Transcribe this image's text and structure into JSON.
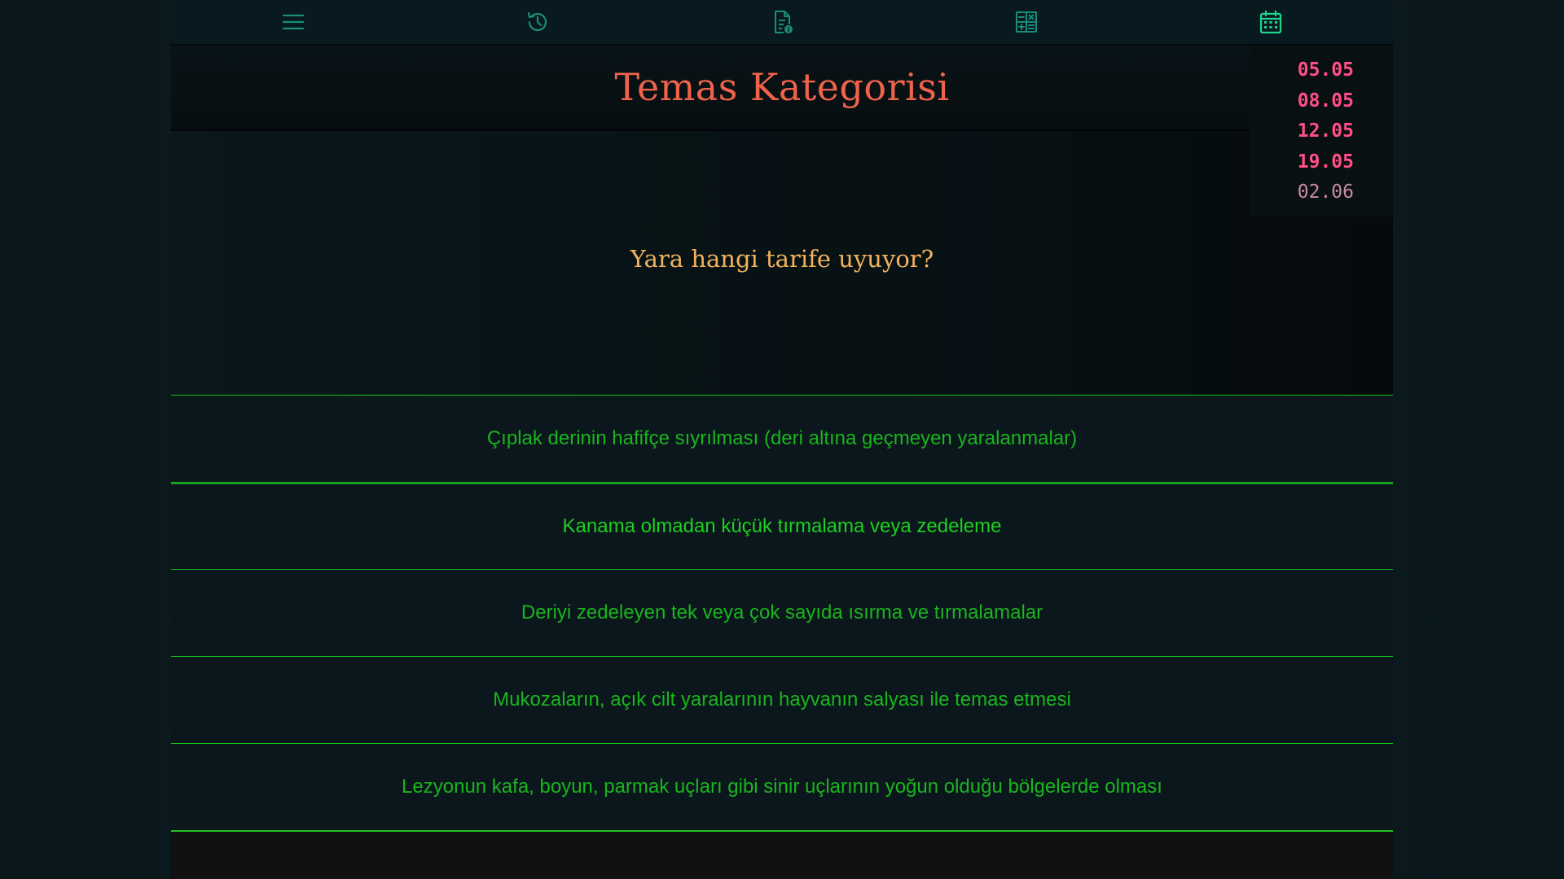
{
  "nav": {
    "items": [
      {
        "icon": "menu-icon"
      },
      {
        "icon": "history-icon"
      },
      {
        "icon": "document-info-icon"
      },
      {
        "icon": "calculator-icon"
      },
      {
        "icon": "calendar-icon",
        "active": true
      }
    ],
    "icon_color": "#1a8c7a",
    "active_color": "#1cd68a"
  },
  "header": {
    "title": "Temas Kategorisi"
  },
  "dates": [
    "05.05",
    "08.05",
    "12.05",
    "19.05",
    "02.06"
  ],
  "question": "Yara hangi tarife uyuyor?",
  "options": [
    "Çıplak derinin hafifçe sıyrılması (deri altına geçmeyen yaralanmalar)",
    "Kanama olmadan küçük tırmalama veya zedeleme",
    "Deriyi zedeleyen tek veya çok sayıda ısırma ve tırmalamalar",
    "Mukozaların, açık cilt yaralarının hayvanın salyası ile temas etmesi",
    "Lezyonun kafa, boyun, parmak uçları gibi sinir uçlarının yoğun olduğu bölgelerde olması"
  ],
  "colors": {
    "title": "#f0634b",
    "question": "#f2b35b",
    "option_text": "#1ab51e",
    "option_border": "#17c41c",
    "date_active": "#ff4f86",
    "date_dim": "#c98aa0"
  }
}
